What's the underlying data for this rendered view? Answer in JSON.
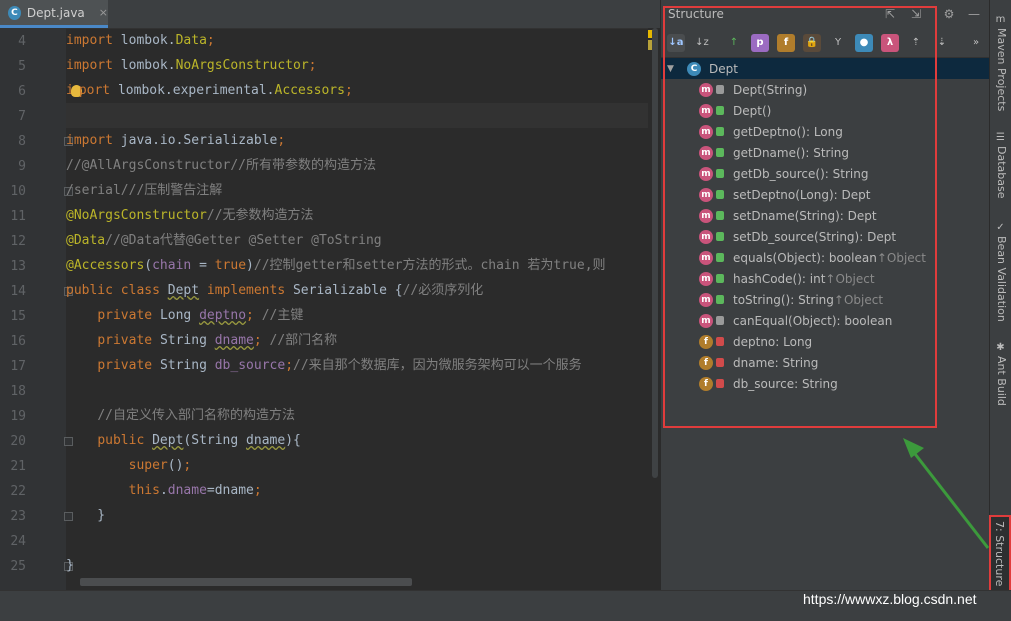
{
  "editor": {
    "tab": {
      "label": "Dept.java",
      "badge": "C",
      "close": "×"
    },
    "lines": [
      {
        "n": "4",
        "segs": [
          [
            "k",
            "import "
          ],
          [
            "v",
            "lombok."
          ],
          [
            "a",
            "Data"
          ],
          [
            "k",
            ";"
          ]
        ]
      },
      {
        "n": "5",
        "segs": [
          [
            "k",
            "import "
          ],
          [
            "v",
            "lombok."
          ],
          [
            "a",
            "NoArgsConstructor"
          ],
          [
            "k",
            ";"
          ]
        ]
      },
      {
        "n": "6",
        "segs": [
          [
            "k",
            "i"
          ],
          [
            "bulb",
            ""
          ],
          [
            "k",
            "port "
          ],
          [
            "v",
            "lombok.experimental."
          ],
          [
            "a",
            "Accessors"
          ],
          [
            "k",
            ";"
          ]
        ]
      },
      {
        "n": "7",
        "segs": []
      },
      {
        "n": "8",
        "segs": [
          [
            "k",
            "import "
          ],
          [
            "v",
            "java.io.Serializable"
          ],
          [
            "k",
            ";"
          ]
        ]
      },
      {
        "n": "9",
        "segs": [
          [
            "c",
            "//@AllArgsConstructor//所有带参数的构造方法"
          ]
        ]
      },
      {
        "n": "10",
        "segs": [
          [
            "c",
            "/serial///压制警告注解"
          ]
        ]
      },
      {
        "n": "11",
        "segs": [
          [
            "a",
            "@NoArgsConstructor"
          ],
          [
            "c",
            "//无参数构造方法"
          ]
        ]
      },
      {
        "n": "12",
        "segs": [
          [
            "a",
            "@Data"
          ],
          [
            "c",
            "//@Data代替@Getter @Setter @ToString"
          ]
        ]
      },
      {
        "n": "13",
        "segs": [
          [
            "a",
            "@Accessors"
          ],
          [
            "v",
            "("
          ],
          [
            "f",
            "chain"
          ],
          [
            "v",
            " = "
          ],
          [
            "k",
            "true"
          ],
          [
            "v",
            ")"
          ],
          [
            "c",
            "//控制getter和setter方法的形式。chain 若为true,则"
          ]
        ]
      },
      {
        "n": "14",
        "segs": [
          [
            "k",
            "public class "
          ],
          [
            "w",
            "Dept"
          ],
          [
            "k",
            " implements "
          ],
          [
            "v",
            "Serializable {"
          ],
          [
            "c",
            "//必须序列化"
          ]
        ]
      },
      {
        "n": "15",
        "segs": [
          [
            "v",
            "    "
          ],
          [
            "k",
            "private "
          ],
          [
            "v",
            "Long "
          ],
          [
            "fw",
            "deptno"
          ],
          [
            "k",
            ";"
          ],
          [
            "c",
            " //主键"
          ]
        ]
      },
      {
        "n": "16",
        "segs": [
          [
            "v",
            "    "
          ],
          [
            "k",
            "private "
          ],
          [
            "v",
            "String "
          ],
          [
            "fw",
            "dname"
          ],
          [
            "k",
            ";"
          ],
          [
            "c",
            " //部门名称"
          ]
        ]
      },
      {
        "n": "17",
        "segs": [
          [
            "v",
            "    "
          ],
          [
            "k",
            "private "
          ],
          [
            "v",
            "String "
          ],
          [
            "f",
            "db_source"
          ],
          [
            "k",
            ";"
          ],
          [
            "c",
            "//来自那个数据库，因为微服务架构可以一个服务"
          ]
        ]
      },
      {
        "n": "18",
        "segs": []
      },
      {
        "n": "19",
        "segs": [
          [
            "v",
            "    "
          ],
          [
            "c",
            "//自定义传入部门名称的构造方法"
          ]
        ]
      },
      {
        "n": "20",
        "segs": [
          [
            "v",
            "    "
          ],
          [
            "k",
            "public "
          ],
          [
            "w",
            "Dept"
          ],
          [
            "v",
            "(String "
          ],
          [
            "w",
            "dname"
          ],
          [
            "v",
            "){"
          ]
        ]
      },
      {
        "n": "21",
        "segs": [
          [
            "v",
            "        "
          ],
          [
            "k",
            "super"
          ],
          [
            "v",
            "()"
          ],
          [
            "k",
            ";"
          ]
        ]
      },
      {
        "n": "22",
        "segs": [
          [
            "v",
            "        "
          ],
          [
            "k",
            "this"
          ],
          [
            "v",
            "."
          ],
          [
            "f",
            "dname"
          ],
          [
            "v",
            "=dname"
          ],
          [
            "k",
            ";"
          ]
        ]
      },
      {
        "n": "23",
        "segs": [
          [
            "v",
            "    }"
          ]
        ]
      },
      {
        "n": "24",
        "segs": []
      },
      {
        "n": "25",
        "segs": [
          [
            "v",
            "}"
          ]
        ]
      }
    ]
  },
  "structure": {
    "title": "Structure",
    "header_buttons": [
      "⇱",
      "⇲",
      "⚙",
      "—"
    ],
    "toolbar": [
      {
        "label": "↓a",
        "name": "sort-by-visibility-button",
        "bg": "#4a4d4f",
        "fg": "#9fc6ff"
      },
      {
        "label": "↓z",
        "name": "sort-alphabetically-button",
        "bg": "transparent",
        "fg": "#c0c0c0"
      },
      {
        "label": "↑",
        "name": "show-inherited-button",
        "bg": "transparent",
        "fg": "#5cb85c"
      },
      {
        "label": "p",
        "name": "show-properties-button",
        "bg": "#9b6bc2",
        "fg": "#ffffff"
      },
      {
        "label": "f",
        "name": "show-fields-button",
        "bg": "#b07d2c",
        "fg": "#ffffff"
      },
      {
        "label": "🔒",
        "name": "show-non-public-button",
        "bg": "#5a4a3a",
        "fg": "#e06060"
      },
      {
        "label": "Y",
        "name": "group-by-button",
        "bg": "transparent",
        "fg": "#c0c0c0"
      },
      {
        "label": "●",
        "name": "show-anonymous-button",
        "bg": "#3d8ab8",
        "fg": "#ffffff"
      },
      {
        "label": "λ",
        "name": "show-lambdas-button",
        "bg": "#c9547b",
        "fg": "#ffffff"
      },
      {
        "label": "⇡",
        "name": "expand-all-button",
        "bg": "transparent",
        "fg": "#c0c0c0"
      },
      {
        "label": "⇣",
        "name": "collapse-all-button",
        "bg": "transparent",
        "fg": "#c0c0c0"
      },
      {
        "label": "»",
        "name": "more-button",
        "bg": "transparent",
        "fg": "#c0c0c0"
      }
    ],
    "root": {
      "label": "Dept",
      "badge": "C",
      "triangle": "▼"
    },
    "items": [
      {
        "kind": "m",
        "vis": "prot",
        "text": "Dept(String)",
        "inh": ""
      },
      {
        "kind": "m",
        "vis": "pub",
        "text": "Dept()",
        "inh": ""
      },
      {
        "kind": "m",
        "vis": "pub",
        "text": "getDeptno(): Long",
        "inh": ""
      },
      {
        "kind": "m",
        "vis": "pub",
        "text": "getDname(): String",
        "inh": ""
      },
      {
        "kind": "m",
        "vis": "pub",
        "text": "getDb_source(): String",
        "inh": ""
      },
      {
        "kind": "m",
        "vis": "pub",
        "text": "setDeptno(Long): Dept",
        "inh": ""
      },
      {
        "kind": "m",
        "vis": "pub",
        "text": "setDname(String): Dept",
        "inh": ""
      },
      {
        "kind": "m",
        "vis": "pub",
        "text": "setDb_source(String): Dept",
        "inh": ""
      },
      {
        "kind": "m",
        "vis": "pub",
        "text": "equals(Object): boolean ",
        "inh": "↑Object"
      },
      {
        "kind": "m",
        "vis": "pub",
        "text": "hashCode(): int ",
        "inh": "↑Object"
      },
      {
        "kind": "m",
        "vis": "pub",
        "text": "toString(): String ",
        "inh": "↑Object"
      },
      {
        "kind": "m",
        "vis": "prot",
        "text": "canEqual(Object): boolean",
        "inh": ""
      },
      {
        "kind": "f",
        "vis": "priv",
        "text": "deptno: Long",
        "inh": ""
      },
      {
        "kind": "f",
        "vis": "priv",
        "text": "dname: String",
        "inh": ""
      },
      {
        "kind": "f",
        "vis": "priv",
        "text": "db_source: String",
        "inh": ""
      }
    ]
  },
  "right_tabs": [
    {
      "label": "Maven Projects",
      "icon": "m",
      "name": "maven-projects-tab"
    },
    {
      "label": "Database",
      "icon": "☰",
      "name": "database-tab"
    },
    {
      "label": "Bean Validation",
      "icon": "✓",
      "name": "bean-validation-tab"
    },
    {
      "label": "Ant Build",
      "icon": "✱",
      "name": "ant-build-tab"
    }
  ],
  "structure_tab": {
    "label": "7: Structure"
  },
  "watermark": "https://wwwxz.blog.csdn.net"
}
